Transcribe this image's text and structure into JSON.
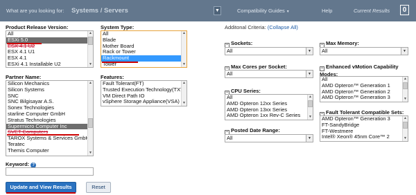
{
  "search": {
    "prefix": "What are you looking for:",
    "value": "Systems / Servers"
  },
  "nav": {
    "compatibility_guides": "Compatibility Guides",
    "help": "Help",
    "current_results_label": "Current Results",
    "current_results_count": "0"
  },
  "product_release": {
    "label": "Product Release Version:",
    "options": [
      "All",
      "ESXi 5.0",
      "ESX 4.1 U2",
      "ESX 4.1 U1",
      "ESX 4.1",
      "ESXi 4.1 Installable U2"
    ]
  },
  "system_type": {
    "label": "System Type:",
    "options": [
      "All",
      "Blade",
      "Mother Board",
      "Rack or Tower",
      "Rackmount",
      "Tower"
    ]
  },
  "partner": {
    "label": "Partner Name:",
    "options": [
      "Silicon Mechanics",
      "Silicon Systems",
      "SNC",
      "SNC Bilgisayar A.S.",
      "Sonex Technologies",
      "starline Computer GmbH",
      "Stratus Technologies",
      "Supermicro Computer Inc",
      "SVET Computers",
      "TAROX Systems & Services GmbH",
      "Teratec",
      "Themis Computer"
    ]
  },
  "features": {
    "label": "Features:",
    "options": [
      "Fault Tolerant(FT)",
      "Trusted Execution Technology(TXT)",
      "VM Direct Path IO",
      "vSphere Storage Appliance(VSA)"
    ]
  },
  "keyword": {
    "label": "Keyword:",
    "value": ""
  },
  "buttons": {
    "update": "Update and View Results",
    "reset": "Reset"
  },
  "criteria": {
    "title": "Additonal Criteria:",
    "collapse_all": "(Collapse All)",
    "sockets": {
      "label": "Sockets:",
      "value": "All"
    },
    "max_memory": {
      "label": "Max Memory:",
      "value": "All"
    },
    "max_cores": {
      "label": "Max Cores per Socket:",
      "value": "All"
    },
    "evc": {
      "label": "Enhanced vMotion Capability Modes:",
      "options": [
        "All",
        "AMD Opteron™ Generation 1",
        "AMD Opteron™ Generation 2",
        "AMD Opteron™ Generation 3"
      ]
    },
    "cpu_series": {
      "label": "CPU Series:",
      "options": [
        "All",
        "AMD Opteron 12xx Series",
        "AMD Opteron 13xx Series",
        "AMD Opteron 1xx Rev-C Series"
      ]
    },
    "ft_sets": {
      "label": "Fault Tolerant Compatible Sets:",
      "options": [
        "AMD Opteron™ Generation 3",
        "FT-SandyBridge",
        "FT-Westmere",
        "Intel® Xeon® 45nm Core™ 2"
      ]
    },
    "posted_date": {
      "label": "Posted Date Range:",
      "value": "All"
    }
  },
  "icons": {
    "dropdown": "chevron-down-icon",
    "collapse": "minus-icon",
    "help": "question-icon"
  },
  "colors": {
    "topbar": "#63778d",
    "selected_gray": "#6e6e6e",
    "selected_blue": "#3399ff",
    "primary_button": "#2a72c0",
    "annotation_red": "#cc0000"
  }
}
